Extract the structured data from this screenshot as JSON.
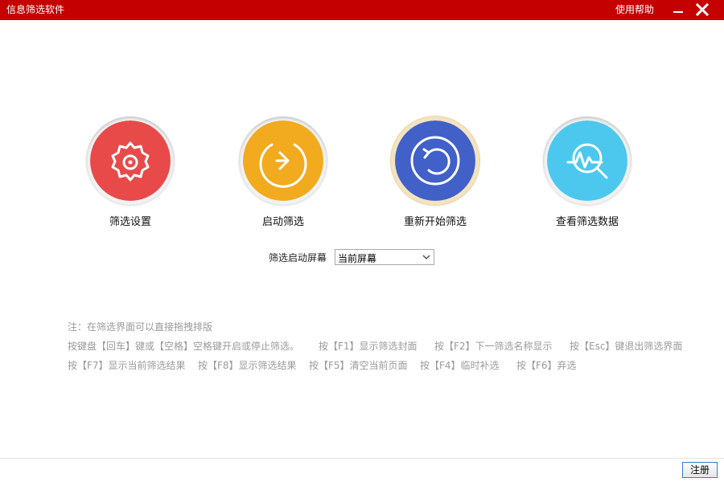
{
  "window": {
    "title": "信息筛选软件",
    "help_label": "使用帮助",
    "titlebar_color": "#c40000"
  },
  "actions": [
    {
      "label": "筛选设置",
      "icon": "gear-icon",
      "color": "#e84a4a"
    },
    {
      "label": "启动筛选",
      "icon": "play-arrow-icon",
      "color": "#f2aa1f"
    },
    {
      "label": "重新开始筛选",
      "icon": "restart-icon",
      "color": "#4160c8"
    },
    {
      "label": "查看筛选数据",
      "icon": "chart-search-icon",
      "color": "#4cc8ef"
    }
  ],
  "screen_select": {
    "label": "筛选启动屏幕",
    "value": "当前屏幕"
  },
  "notes": {
    "line1": "注：在筛选界面可以直接拖拽排版",
    "line2": [
      "按键盘【回车】键或【空格】空格键开启或停止筛选。",
      "按【F1】显示筛选封面",
      "按【F2】下一筛选名称显示",
      "按【Esc】键退出筛选界面"
    ],
    "line3": [
      "按【F7】显示当前筛选结果",
      "按【F8】显示筛选结果",
      "按【F5】清空当前页面",
      "按【F4】临时补选",
      "按【F6】弃选"
    ]
  },
  "footer": {
    "register_label": "注册"
  }
}
